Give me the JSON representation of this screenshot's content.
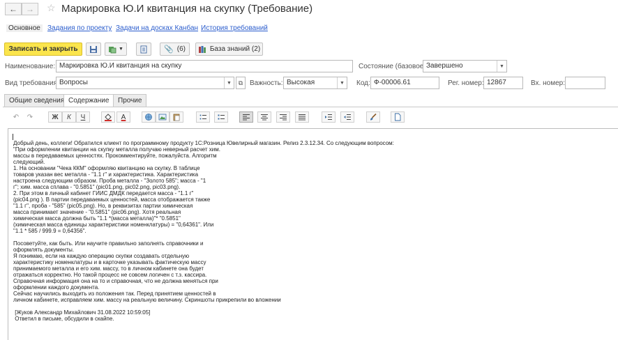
{
  "window": {
    "back_icon": "arrow-left-icon",
    "forward_icon": "arrow-right-icon",
    "favorite_icon": "star-icon",
    "title": "Маркировка Ю.И квитанция на скупку (Требование)"
  },
  "page_tabs": [
    {
      "label": "Основное",
      "active": true
    },
    {
      "label": "Задания по проекту",
      "active": false
    },
    {
      "label": "Задачи на досках Канбан",
      "active": false
    },
    {
      "label": "История требований",
      "active": false
    }
  ],
  "toolbar": {
    "save_close": "Записать и закрыть",
    "attachments_count": "(6)",
    "knowledge_base": "База знаний (2)"
  },
  "form": {
    "name_label": "Наименование:",
    "name_value": "Маркировка Ю.И квитанция на скупку",
    "state_label": "Состояние (базовое):",
    "state_value": "Завершено",
    "type_label": "Вид требования:",
    "type_value": "Вопросы",
    "priority_label": "Важность:",
    "priority_value": "Высокая",
    "code_label": "Код:",
    "code_value": "Ф-00006.61",
    "reg_label": "Рег. номер:",
    "reg_value": "12867",
    "in_label": "Вх. номер:",
    "in_value": ""
  },
  "form_tabs": [
    "Общие сведения",
    "Содержание",
    "Прочие"
  ],
  "format_toolbar": {
    "bold": "Ж",
    "italic": "К",
    "underline": "Ч",
    "font_color": "A"
  },
  "content": {
    "lines": [
      "Добрый день, коллеги! Обратился клиент по программному продукту 1С:Розница Ювелирный магазин. Релиз 2.3.12.34. Со следующим вопросом:",
      "\"При оформлении квитанции на скупку металла получаю неверный расчет хим.",
      "массы в передаваемых ценностях. Прокомментируйте, пожалуйста. Алгоритм",
      "следующий.",
      "1. На основании \"Чека ККМ\" оформляю квитанцию на скупку. В таблице",
      "товаров указан вес металла - \"1.1 г\" и характеристика. Характеристика",
      "настроена следующим образом. Проба металла - \"Золото 585\"; масса - \"1",
      "г\"; хим. масса сплава - \"0.5851\" (pic01.png, pic02.png, pic03.png).",
      "2. При этом в личный кабинет ГИИС ДМДК передается масса - \"1.1 г\"",
      "(pic04.png ). В партии передаваемых ценностей, масса отображается также",
      "\"1.1 г\", проба - \"585\" (pic05.png). Но, в реквизитах партии химическая",
      "масса принимает значение - \"0.5851\" (pic06.png). Хотя реальная",
      "химическая масса должна быть \"1.1 *(масса металла)\"* \"0.5851\"",
      "(химическая масса единицы характеристики номенклатуры) = \"0,64361\". Или",
      "\"1.1 * 585 / 999.9 = 0,64356\".",
      "",
      "Посоветуйте, как быть. Или научите правильно заполнять справочники и",
      "оформлять документы.",
      "Я понимаю, если на каждую операцию скупки создавать отдельную",
      "характеристику номенклатуры и в карточке указывать фактическую массу",
      "принимаемого металла и его хим. массу, то в личном кабинете она будет",
      "отражаться корректно. Но такой процесс не совсем логичен с т.з. кассира.",
      "Справочная информация она на то и справочная, что не должна меняться при",
      "оформлении каждого документа.",
      "Сейчас научились выходить из положения так. Перед принятием ценностей в",
      "личном кабинете, исправляем хим. массу на реальную величину. Скриншоты прикрепили во вложении",
      "",
      " [Жуков Александр Михайлович 31.08.2022 10:59:05]",
      " Ответил в письме, обсудили в скайпе."
    ]
  }
}
